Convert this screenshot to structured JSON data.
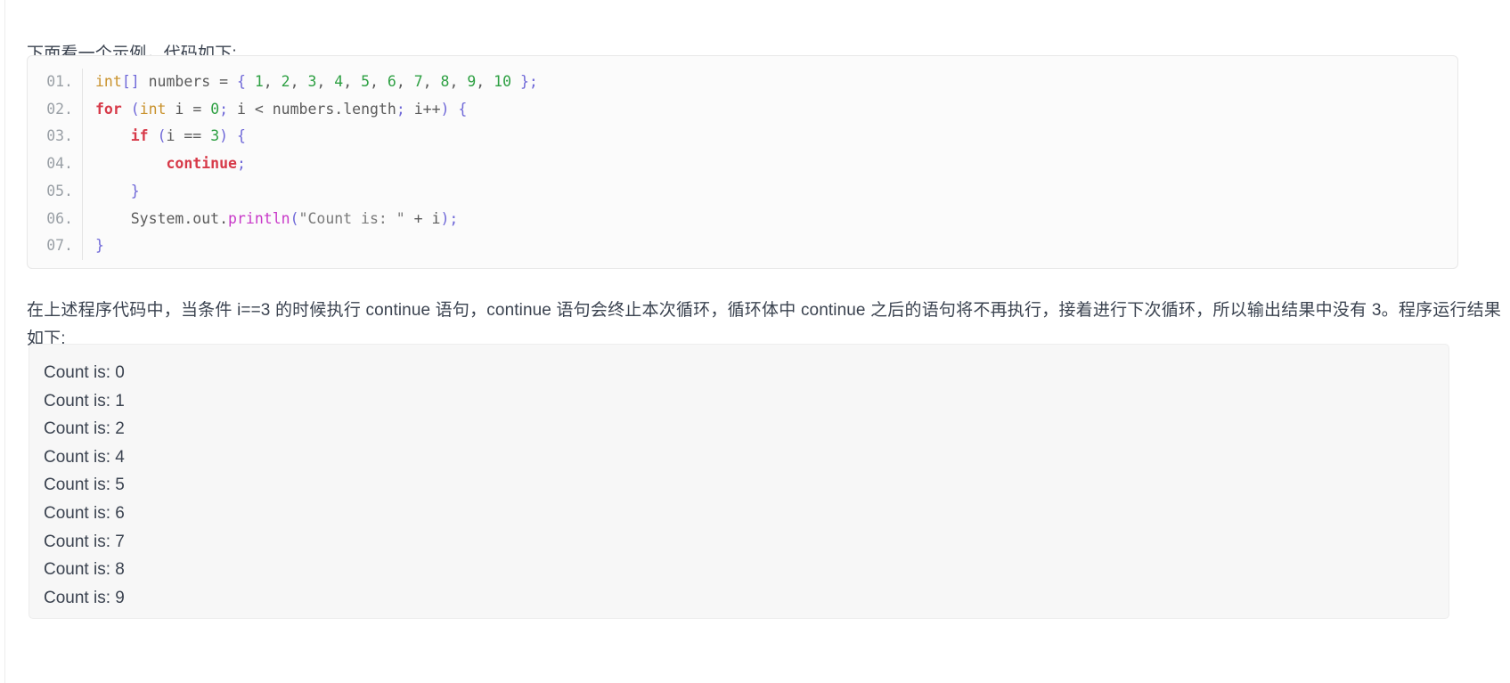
{
  "page": {
    "intro_text": "下面看一个示例，代码如下:",
    "explanation": "在上述程序代码中，当条件 i==3 的时候执行 continue 语句，continue 语句会终止本次循环，循环体中 continue 之后的语句将不再执行，接着进行下次循环，所以输出结果中没有 3。程序运行结果如下:"
  },
  "code_block": {
    "language": "java",
    "line_numbers": [
      "01.",
      "02.",
      "03.",
      "04.",
      "05.",
      "06.",
      "07."
    ],
    "lines": [
      {
        "number": "01.",
        "text": "int[] numbers = { 1, 2, 3, 4, 5, 6, 7, 8, 9, 10 };",
        "tokens": [
          {
            "t": "int",
            "c": "type"
          },
          {
            "t": "[]",
            "c": "brace"
          },
          {
            "t": " numbers ",
            "c": "plain"
          },
          {
            "t": "=",
            "c": "op"
          },
          {
            "t": " ",
            "c": "plain"
          },
          {
            "t": "{",
            "c": "brace"
          },
          {
            "t": " ",
            "c": "plain"
          },
          {
            "t": "1",
            "c": "num"
          },
          {
            "t": ", ",
            "c": "plain"
          },
          {
            "t": "2",
            "c": "num"
          },
          {
            "t": ", ",
            "c": "plain"
          },
          {
            "t": "3",
            "c": "num"
          },
          {
            "t": ", ",
            "c": "plain"
          },
          {
            "t": "4",
            "c": "num"
          },
          {
            "t": ", ",
            "c": "plain"
          },
          {
            "t": "5",
            "c": "num"
          },
          {
            "t": ", ",
            "c": "plain"
          },
          {
            "t": "6",
            "c": "num"
          },
          {
            "t": ", ",
            "c": "plain"
          },
          {
            "t": "7",
            "c": "num"
          },
          {
            "t": ", ",
            "c": "plain"
          },
          {
            "t": "8",
            "c": "num"
          },
          {
            "t": ", ",
            "c": "plain"
          },
          {
            "t": "9",
            "c": "num"
          },
          {
            "t": ", ",
            "c": "plain"
          },
          {
            "t": "10",
            "c": "num"
          },
          {
            "t": " ",
            "c": "plain"
          },
          {
            "t": "}",
            "c": "brace"
          },
          {
            "t": ";",
            "c": "punct"
          }
        ]
      },
      {
        "number": "02.",
        "text": "for (int i = 0; i < numbers.length; i++) {",
        "tokens": [
          {
            "t": "for",
            "c": "kw"
          },
          {
            "t": " ",
            "c": "plain"
          },
          {
            "t": "(",
            "c": "paren"
          },
          {
            "t": "int",
            "c": "type"
          },
          {
            "t": " i ",
            "c": "plain"
          },
          {
            "t": "=",
            "c": "op"
          },
          {
            "t": " ",
            "c": "plain"
          },
          {
            "t": "0",
            "c": "num"
          },
          {
            "t": ";",
            "c": "punct"
          },
          {
            "t": " i ",
            "c": "plain"
          },
          {
            "t": "<",
            "c": "op"
          },
          {
            "t": " numbers.length",
            "c": "plain"
          },
          {
            "t": ";",
            "c": "punct"
          },
          {
            "t": " i",
            "c": "plain"
          },
          {
            "t": "++",
            "c": "op"
          },
          {
            "t": ")",
            "c": "paren"
          },
          {
            "t": " ",
            "c": "plain"
          },
          {
            "t": "{",
            "c": "brace"
          }
        ]
      },
      {
        "number": "03.",
        "text": "    if (i == 3) {",
        "tokens": [
          {
            "t": "    ",
            "c": "plain"
          },
          {
            "t": "if",
            "c": "kw"
          },
          {
            "t": " ",
            "c": "plain"
          },
          {
            "t": "(",
            "c": "paren"
          },
          {
            "t": "i ",
            "c": "plain"
          },
          {
            "t": "==",
            "c": "op"
          },
          {
            "t": " ",
            "c": "plain"
          },
          {
            "t": "3",
            "c": "num"
          },
          {
            "t": ")",
            "c": "paren"
          },
          {
            "t": " ",
            "c": "plain"
          },
          {
            "t": "{",
            "c": "brace"
          }
        ]
      },
      {
        "number": "04.",
        "text": "        continue;",
        "tokens": [
          {
            "t": "        ",
            "c": "plain"
          },
          {
            "t": "continue",
            "c": "kw"
          },
          {
            "t": ";",
            "c": "punct"
          }
        ]
      },
      {
        "number": "05.",
        "text": "    }",
        "tokens": [
          {
            "t": "    ",
            "c": "plain"
          },
          {
            "t": "}",
            "c": "brace"
          }
        ]
      },
      {
        "number": "06.",
        "text": "    System.out.println(\"Count is: \" + i);",
        "tokens": [
          {
            "t": "    ",
            "c": "plain"
          },
          {
            "t": "System.out.",
            "c": "plain"
          },
          {
            "t": "println",
            "c": "fn"
          },
          {
            "t": "(",
            "c": "paren"
          },
          {
            "t": "\"Count is: \"",
            "c": "str"
          },
          {
            "t": " ",
            "c": "plain"
          },
          {
            "t": "+",
            "c": "op"
          },
          {
            "t": " i",
            "c": "plain"
          },
          {
            "t": ")",
            "c": "paren"
          },
          {
            "t": ";",
            "c": "punct"
          }
        ]
      },
      {
        "number": "07.",
        "text": "}",
        "tokens": [
          {
            "t": "}",
            "c": "brace"
          }
        ]
      }
    ]
  },
  "output_block": {
    "lines": [
      "Count is: 0",
      "Count is: 1",
      "Count is: 2",
      "Count is: 4",
      "Count is: 5",
      "Count is: 6",
      "Count is: 7",
      "Count is: 8",
      "Count is: 9"
    ]
  },
  "colors": {
    "page_background": "#ffffff",
    "text": "#3b4350",
    "code_block_background": "#fbfbfb",
    "code_block_border": "#e8e8e8",
    "gutter_text": "#9aa0a6",
    "output_background": "#f7f7f7",
    "output_border": "#ededed",
    "token_keyword": "#d73a49",
    "token_type": "#c9922c",
    "token_number": "#2ea043",
    "token_brace": "#6f68d8",
    "token_function": "#c838c8",
    "token_string": "#7a7a7a",
    "token_plain": "#5a5a5a"
  }
}
